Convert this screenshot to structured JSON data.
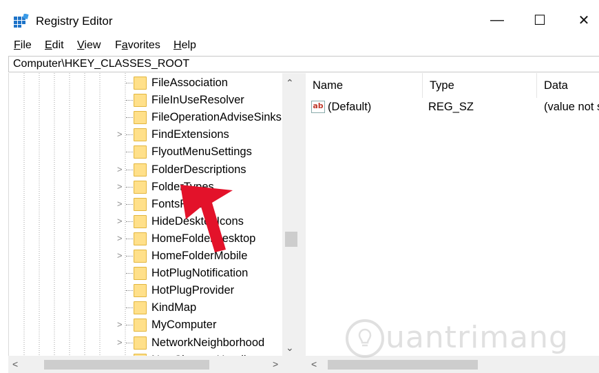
{
  "window": {
    "title": "Registry Editor",
    "minimize_glyph": "—",
    "maximize_glyph": "☐",
    "close_glyph": "✕"
  },
  "menu": [
    {
      "label": "File",
      "accel": "F",
      "rest": "ile"
    },
    {
      "label": "Edit",
      "accel": "E",
      "rest": "dit"
    },
    {
      "label": "View",
      "accel": "V",
      "rest": "iew"
    },
    {
      "label": "Favorites",
      "pre": "F",
      "accel": "a",
      "rest": "vorites"
    },
    {
      "label": "Help",
      "accel": "H",
      "rest": "elp"
    }
  ],
  "address": "Computer\\HKEY_CLASSES_ROOT",
  "tree": [
    {
      "label": "FileAssociation",
      "expandable": false
    },
    {
      "label": "FileInUseResolver",
      "expandable": false
    },
    {
      "label": "FileOperationAdviseSinks",
      "expandable": false
    },
    {
      "label": "FindExtensions",
      "expandable": true
    },
    {
      "label": "FlyoutMenuSettings",
      "expandable": false
    },
    {
      "label": "FolderDescriptions",
      "expandable": true
    },
    {
      "label": "FolderTypes",
      "expandable": true
    },
    {
      "label": "FontsFolder",
      "expandable": true
    },
    {
      "label": "HideDesktopIcons",
      "expandable": true
    },
    {
      "label": "HomeFolderDesktop",
      "expandable": true
    },
    {
      "label": "HomeFolderMobile",
      "expandable": true
    },
    {
      "label": "HotPlugNotification",
      "expandable": false
    },
    {
      "label": "HotPlugProvider",
      "expandable": false
    },
    {
      "label": "KindMap",
      "expandable": false
    },
    {
      "label": "MyComputer",
      "expandable": true
    },
    {
      "label": "NetworkNeighborhood",
      "expandable": true
    },
    {
      "label": "NewShortcutHandlers",
      "expandable": false
    }
  ],
  "columns": {
    "name": "Name",
    "type": "Type",
    "data": "Data"
  },
  "values": [
    {
      "icon": "ab",
      "name": "(Default)",
      "type": "REG_SZ",
      "data": "(value not set)"
    }
  ],
  "watermark": {
    "text": "uantrimang"
  },
  "colors": {
    "folder": "#ffe08a",
    "arrow": "#e3122a",
    "scrollbar": "#f0f0f0"
  }
}
